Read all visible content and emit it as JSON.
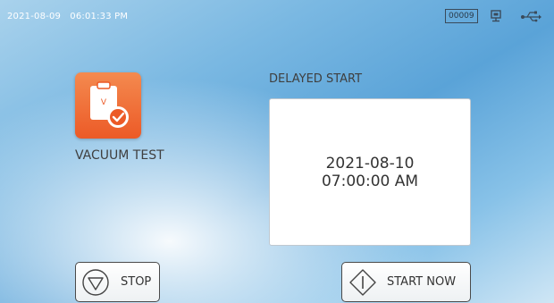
{
  "status_bar": {
    "datetime": "2021-08-09   06:01:33 PM",
    "counter": "00009",
    "icons": [
      "network-icon",
      "usb-icon"
    ]
  },
  "program": {
    "label": "VACUUM TEST",
    "icon": "clipboard-check-icon",
    "icon_letter": "V"
  },
  "delayed_start": {
    "title": "DELAYED START",
    "date": "2021-08-10",
    "time": "07:00:00 AM"
  },
  "buttons": {
    "stop_label": "STOP",
    "start_now_label": "START NOW"
  },
  "colors": {
    "tile_orange": "#ec5a27",
    "background_blue": "#5aa3d8"
  }
}
